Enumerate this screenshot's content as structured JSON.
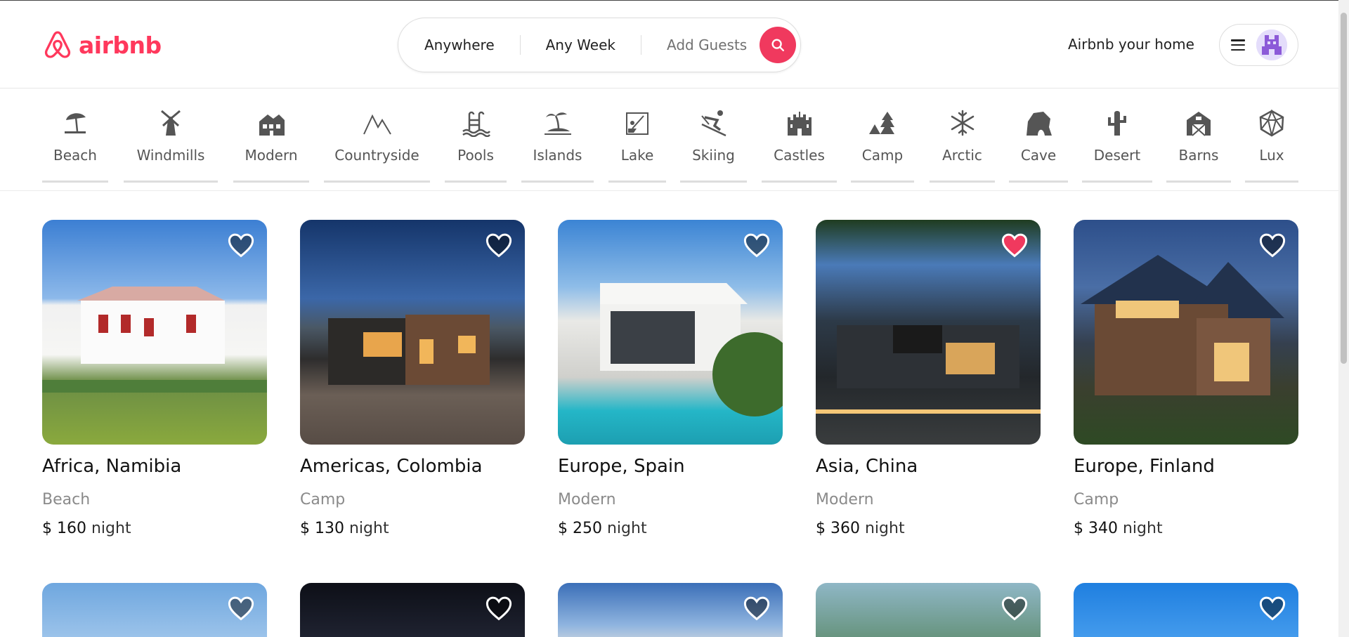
{
  "brand": {
    "name": "airbnb",
    "color": "#FF385C"
  },
  "search": {
    "where": "Anywhere",
    "when": "Any Week",
    "guests": "Add Guests",
    "button_icon": "search-icon"
  },
  "header": {
    "host_link": "Airbnb your home",
    "menu_icon": "menu-icon",
    "avatar_icon": "avatar"
  },
  "categories": [
    {
      "label": "Beach",
      "icon": "beach-icon"
    },
    {
      "label": "Windmills",
      "icon": "windmill-icon"
    },
    {
      "label": "Modern",
      "icon": "modern-icon"
    },
    {
      "label": "Countryside",
      "icon": "countryside-icon"
    },
    {
      "label": "Pools",
      "icon": "pool-icon"
    },
    {
      "label": "Islands",
      "icon": "island-icon"
    },
    {
      "label": "Lake",
      "icon": "lake-icon"
    },
    {
      "label": "Skiing",
      "icon": "skiing-icon"
    },
    {
      "label": "Castles",
      "icon": "castle-icon"
    },
    {
      "label": "Camp",
      "icon": "camp-icon"
    },
    {
      "label": "Arctic",
      "icon": "arctic-icon"
    },
    {
      "label": "Cave",
      "icon": "cave-icon"
    },
    {
      "label": "Desert",
      "icon": "desert-icon"
    },
    {
      "label": "Barns",
      "icon": "barn-icon"
    },
    {
      "label": "Lux",
      "icon": "lux-icon"
    }
  ],
  "listings": [
    {
      "location": "Africa, Namibia",
      "category": "Beach",
      "price": "$ 160",
      "unit": "night",
      "favorited": false
    },
    {
      "location": "Americas, Colombia",
      "category": "Camp",
      "price": "$ 130",
      "unit": "night",
      "favorited": false
    },
    {
      "location": "Europe, Spain",
      "category": "Modern",
      "price": "$ 250",
      "unit": "night",
      "favorited": false
    },
    {
      "location": "Asia, China",
      "category": "Modern",
      "price": "$ 360",
      "unit": "night",
      "favorited": true
    },
    {
      "location": "Europe, Finland",
      "category": "Camp",
      "price": "$ 340",
      "unit": "night",
      "favorited": false
    }
  ],
  "colors": {
    "accent": "#FF385C",
    "heart_active": "#F0395E"
  }
}
